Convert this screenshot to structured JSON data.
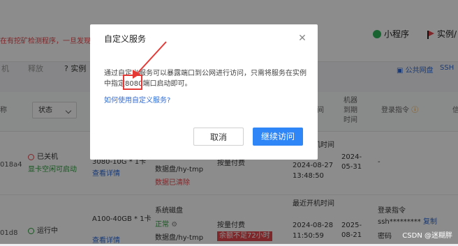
{
  "background": {
    "warning_text": "在有挖矿检测程序，一旦发现自",
    "top_right": {
      "mini_program_label": "小程序",
      "instance_label": "实例/"
    },
    "toolbar": {
      "left_label": "机",
      "release_label": "释放",
      "instance_label": "实例",
      "public_disk_label": "公共网盘",
      "ssh_label": "SSH"
    },
    "table_headers": {
      "col0": "称",
      "status_select": "状态",
      "col_time": "间",
      "col_expire": "机器到期时间",
      "col_login": "登录指令",
      "col_last": "信"
    },
    "rows": [
      {
        "id": "018a4",
        "status": "已关机",
        "status_sub": "显卡空闲可启动",
        "gpu": "3080-10G * 1卡",
        "detail_link": "查看详情",
        "disk": "数据盘/hy-tmp",
        "disk_note": "数据已清除",
        "billing": "按量付费",
        "start_label": "最近开机时间",
        "start_time": "2024-08-27",
        "start_clock": "13:48:50",
        "expire_date": "2024-05-31",
        "login": "-"
      },
      {
        "id": "01d8",
        "status": "运行中",
        "gpu": "A100-40GB * 1卡",
        "detail_link": "查看详情",
        "disk_system": "系统磁盘",
        "disk_state": "正常",
        "disk": "数据盘/hy-tmp",
        "billing": "按量付费",
        "billing_warn": "余额不足72小时",
        "start_label": "最近开机时间",
        "start_time": "2024-08-28",
        "start_clock": "11:50:59",
        "expire_date": "2025-08-21",
        "login_label": "登录指令",
        "login": "ssh*********",
        "copy_label": "复制",
        "password_label": "密码"
      }
    ]
  },
  "modal": {
    "title": "自定义服务",
    "body": "通过自定义服务可以暴露端口到公网进行访问，只需将服务在实例中指定8080端口启动即可。",
    "help_link": "如何使用自定义服务?",
    "cancel_label": "取消",
    "continue_label": "继续访问",
    "close_icon": "close-icon"
  },
  "annotation": {
    "color": "#e53935"
  },
  "watermark": "CSDN @迷糊胖",
  "colors": {
    "primary": "#2f86f6",
    "danger": "#e5484d",
    "success": "#2a9d3a",
    "link": "#2f6bd7"
  }
}
